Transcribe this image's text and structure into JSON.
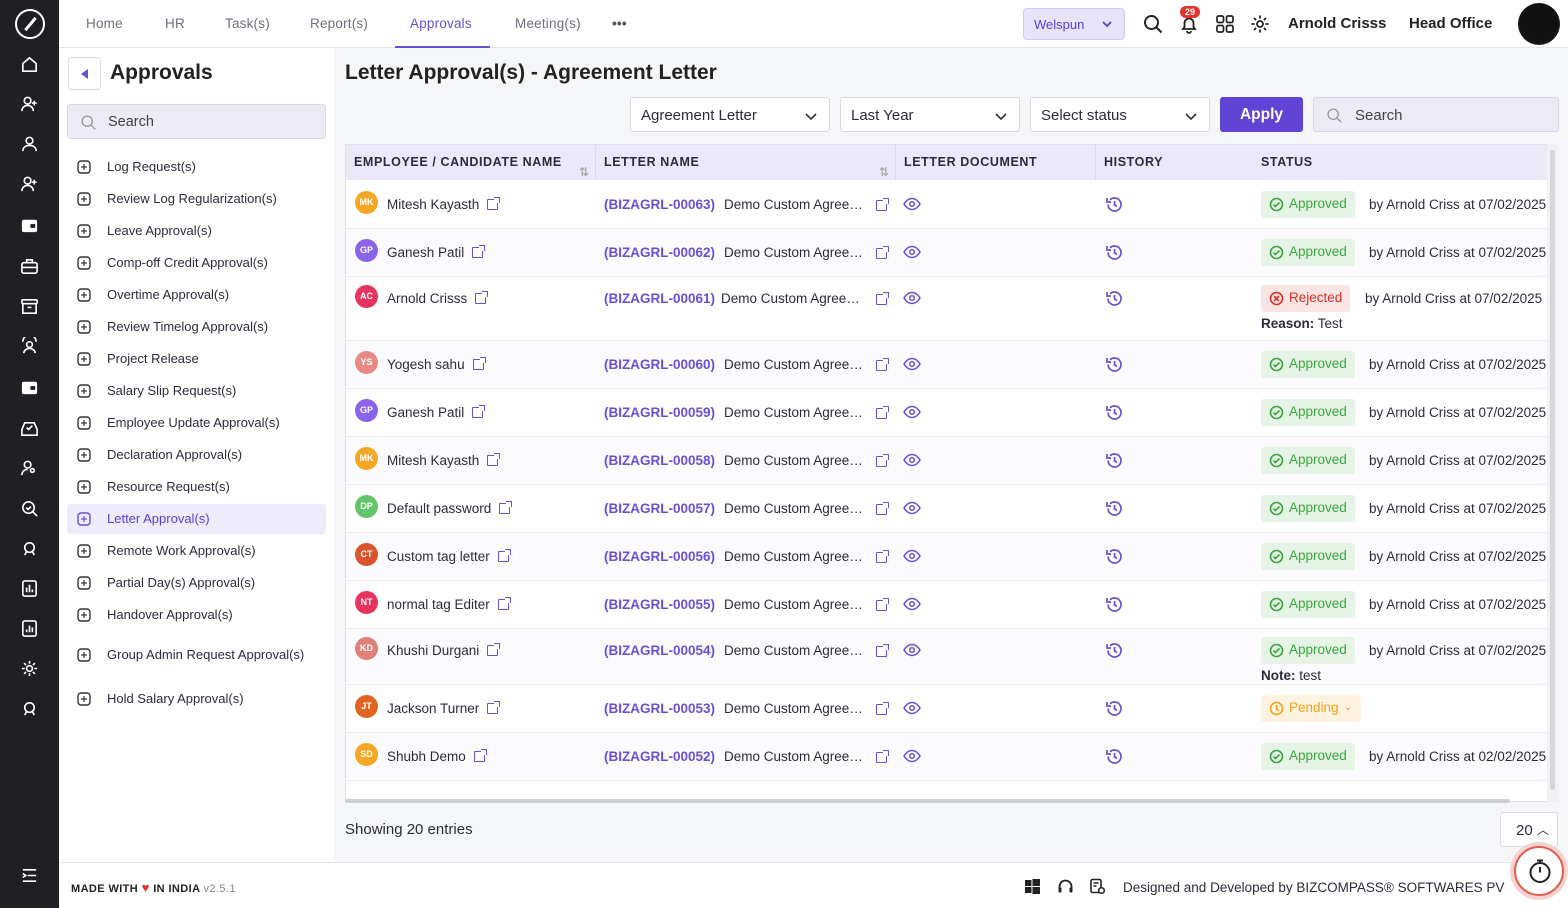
{
  "rail": {
    "icons": [
      "home-icon",
      "user-plus-icon",
      "user-icon",
      "user-add-icon",
      "wallet-icon",
      "briefcase-icon",
      "archive-icon",
      "team-icon",
      "wallet-alt-icon",
      "inbox-check-icon",
      "user-settings-icon",
      "search-check-icon",
      "support-icon",
      "report-icon",
      "report-alt-icon",
      "settings-icon",
      "support-alt-icon",
      "expand-menu-icon"
    ]
  },
  "topnav": {
    "items": [
      "Home",
      "HR",
      "Task(s)",
      "Report(s)",
      "Approvals",
      "Meeting(s)"
    ],
    "active": "Approvals",
    "more": "•••",
    "company": "Welspun",
    "notifications": "29",
    "user_name": "Arnold Crisss",
    "location": "Head Office"
  },
  "sidebar": {
    "title": "Approvals",
    "search_placeholder": "Search",
    "items": [
      "Log Request(s)",
      "Review Log Regularization(s)",
      "Leave Approval(s)",
      "Comp-off Credit Approval(s)",
      "Overtime Approval(s)",
      "Review Timelog Approval(s)",
      "Project Release",
      "Salary Slip Request(s)",
      "Employee Update Approval(s)",
      "Declaration Approval(s)",
      "Resource Request(s)",
      "Letter Approval(s)",
      "Remote Work Approval(s)",
      "Partial Day(s) Approval(s)",
      "Handover Approval(s)",
      "Group Admin Request Approval(s)",
      "Hold Salary Approval(s)"
    ],
    "active": "Letter Approval(s)"
  },
  "main": {
    "title": "Letter Approval(s) - Agreement Letter",
    "filters": {
      "letter_type": "Agreement Letter",
      "period": "Last Year",
      "status_placeholder": "Select status",
      "apply": "Apply",
      "search_placeholder": "Search"
    },
    "columns": [
      "EMPLOYEE / CANDIDATE NAME",
      "LETTER NAME",
      "LETTER DOCUMENT",
      "HISTORY",
      "STATUS"
    ],
    "sort_glyph": "⇅",
    "rows": [
      {
        "initials": "MK",
        "name": "Mitesh Kayasth",
        "code": "(BIZAGRL-00063)",
        "letter": "Demo Custom Agreement Letter",
        "status": "Approved",
        "by": "by Arnold Criss at 07/02/2025",
        "note_label": "",
        "note": ""
      },
      {
        "initials": "GP",
        "name": "Ganesh Patil",
        "code": "(BIZAGRL-00062)",
        "letter": "Demo Custom Agreement Letter",
        "status": "Approved",
        "by": "by Arnold Criss at 07/02/2025",
        "note_label": "",
        "note": ""
      },
      {
        "initials": "AC",
        "name": "Arnold Crisss",
        "code": "(BIZAGRL-00061)",
        "letter": "Demo Custom Agreement Letter",
        "status": "Rejected",
        "by": "by Arnold Criss at 07/02/2025",
        "note_label": "Reason:",
        "note": "Test"
      },
      {
        "initials": "YS",
        "name": "Yogesh sahu",
        "code": "(BIZAGRL-00060)",
        "letter": "Demo Custom Agreement Letter",
        "status": "Approved",
        "by": "by Arnold Criss at 07/02/2025",
        "note_label": "",
        "note": ""
      },
      {
        "initials": "GP",
        "name": "Ganesh Patil",
        "code": "(BIZAGRL-00059)",
        "letter": "Demo Custom Agreement Letter",
        "status": "Approved",
        "by": "by Arnold Criss at 07/02/2025",
        "note_label": "",
        "note": ""
      },
      {
        "initials": "MK",
        "name": "Mitesh Kayasth",
        "code": "(BIZAGRL-00058)",
        "letter": "Demo Custom Agreement Letter",
        "status": "Approved",
        "by": "by Arnold Criss at 07/02/2025",
        "note_label": "",
        "note": ""
      },
      {
        "initials": "DP",
        "name": "Default password",
        "code": "(BIZAGRL-00057)",
        "letter": "Demo Custom Agreement Letter",
        "status": "Approved",
        "by": "by Arnold Criss at 07/02/2025",
        "note_label": "",
        "note": ""
      },
      {
        "initials": "CT",
        "name": "Custom tag letter",
        "code": "(BIZAGRL-00056)",
        "letter": "Demo Custom Agreement Letter",
        "status": "Approved",
        "by": "by Arnold Criss at 07/02/2025",
        "note_label": "",
        "note": ""
      },
      {
        "initials": "NT",
        "name": "normal tag Editer",
        "code": "(BIZAGRL-00055)",
        "letter": "Demo Custom Agreement Letter",
        "status": "Approved",
        "by": "by Arnold Criss at 07/02/2025",
        "note_label": "",
        "note": ""
      },
      {
        "initials": "KD",
        "name": "Khushi Durgani",
        "code": "(BIZAGRL-00054)",
        "letter": "Demo Custom Agreement Letter",
        "status": "Approved",
        "by": "by Arnold Criss at 07/02/2025",
        "note_label": "Note:",
        "note": "test"
      },
      {
        "initials": "JT",
        "name": "Jackson Turner",
        "code": "(BIZAGRL-00053)",
        "letter": "Demo Custom Agreement Letter",
        "status": "Pending",
        "by": "",
        "note_label": "",
        "note": ""
      },
      {
        "initials": "SD",
        "name": "Shubh Demo",
        "code": "(BIZAGRL-00052)",
        "letter": "Demo Custom Agreement Letter",
        "status": "Approved",
        "by": "by Arnold Criss at 02/02/2025",
        "note_label": "",
        "note": ""
      }
    ],
    "avatar_colors": {
      "MK": "#f5a623",
      "GP": "#8a63e8",
      "AC": "#e8345c",
      "YS": "#e98a86",
      "DP": "#63c46b",
      "CT": "#d9542c",
      "NT": "#e8345c",
      "KD": "#e0807a",
      "JT": "#e06420",
      "SD": "#f5a623"
    },
    "status_colors": {
      "Approved": "#39a53d",
      "Rejected": "#d93025",
      "Pending": "#f2a21a"
    },
    "showing": "Showing 20 entries",
    "page_size": "20"
  },
  "footer": {
    "made_prefix": "MADE WITH",
    "heart": "♥",
    "made_suffix": "IN INDIA",
    "version": "v2.5.1",
    "designed": "Designed and Developed by",
    "company": "BIZCOMPASS® SOFTWARES PV"
  },
  "accent_color": "#6143d6"
}
